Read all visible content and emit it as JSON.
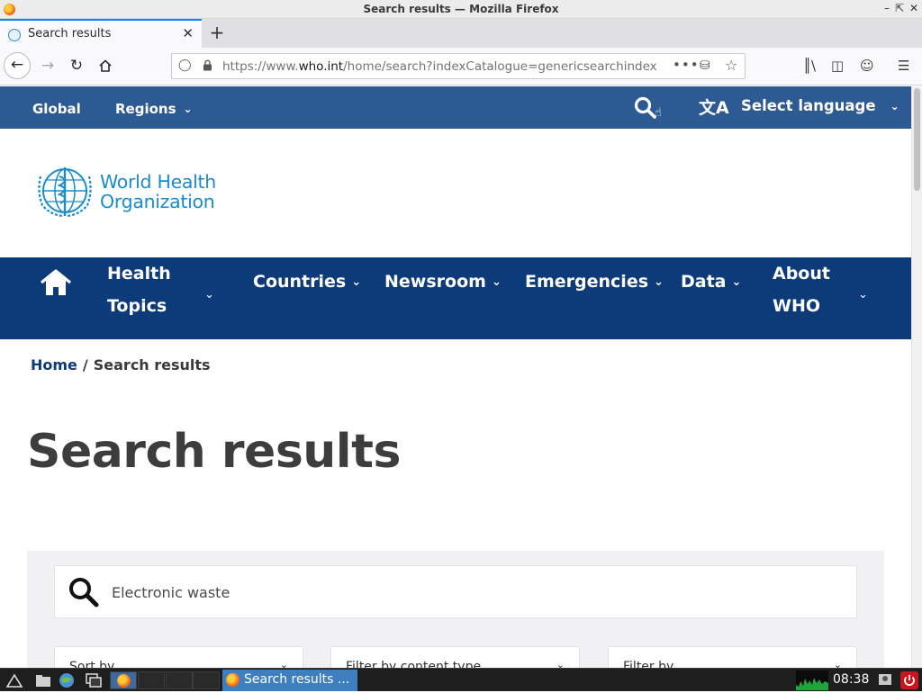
{
  "window": {
    "title": "Search results — Mozilla Firefox"
  },
  "browser": {
    "tab_title": "Search results",
    "url_prefix": "https://www.",
    "url_host": "who.int",
    "url_path": "/home/search?indexCatalogue=genericsearchindex"
  },
  "topbar": {
    "global_label": "Global",
    "regions_label": "Regions",
    "language_label": "Select language"
  },
  "logo": {
    "line1": "World Health",
    "line2": "Organization"
  },
  "mainnav": {
    "health_line1": "Health",
    "health_line2": "Topics",
    "countries": "Countries",
    "newsroom": "Newsroom",
    "emergencies": "Emergencies",
    "data": "Data",
    "about_line1": "About",
    "about_line2": "WHO"
  },
  "breadcrumb": {
    "home": "Home",
    "separator": "/",
    "current": "Search results"
  },
  "page_title": "Search results",
  "search": {
    "value": "Electronic waste"
  },
  "filters": [
    "Sort by",
    "Filter by content type",
    "Filter by"
  ],
  "taskbar": {
    "task_title": "Search results ...",
    "clock": "08:38"
  },
  "colors": {
    "who_blue_top": "#2e5a93",
    "who_navy": "#0d3b7a",
    "who_logo_blue": "#1a8ccd",
    "firefox_accent": "#0a84ff"
  },
  "icons": [
    "firefox-icon",
    "who-favicon",
    "close-icon",
    "plus-icon",
    "back-arrow-icon",
    "forward-arrow-icon",
    "reload-icon",
    "home-icon",
    "shield-icon",
    "lock-icon",
    "ellipsis-icon",
    "pocket-icon",
    "star-icon",
    "library-icon",
    "sidebar-icon",
    "account-icon",
    "hamburger-menu-icon",
    "search-icon",
    "translate-icon",
    "chevron-down-icon"
  ]
}
